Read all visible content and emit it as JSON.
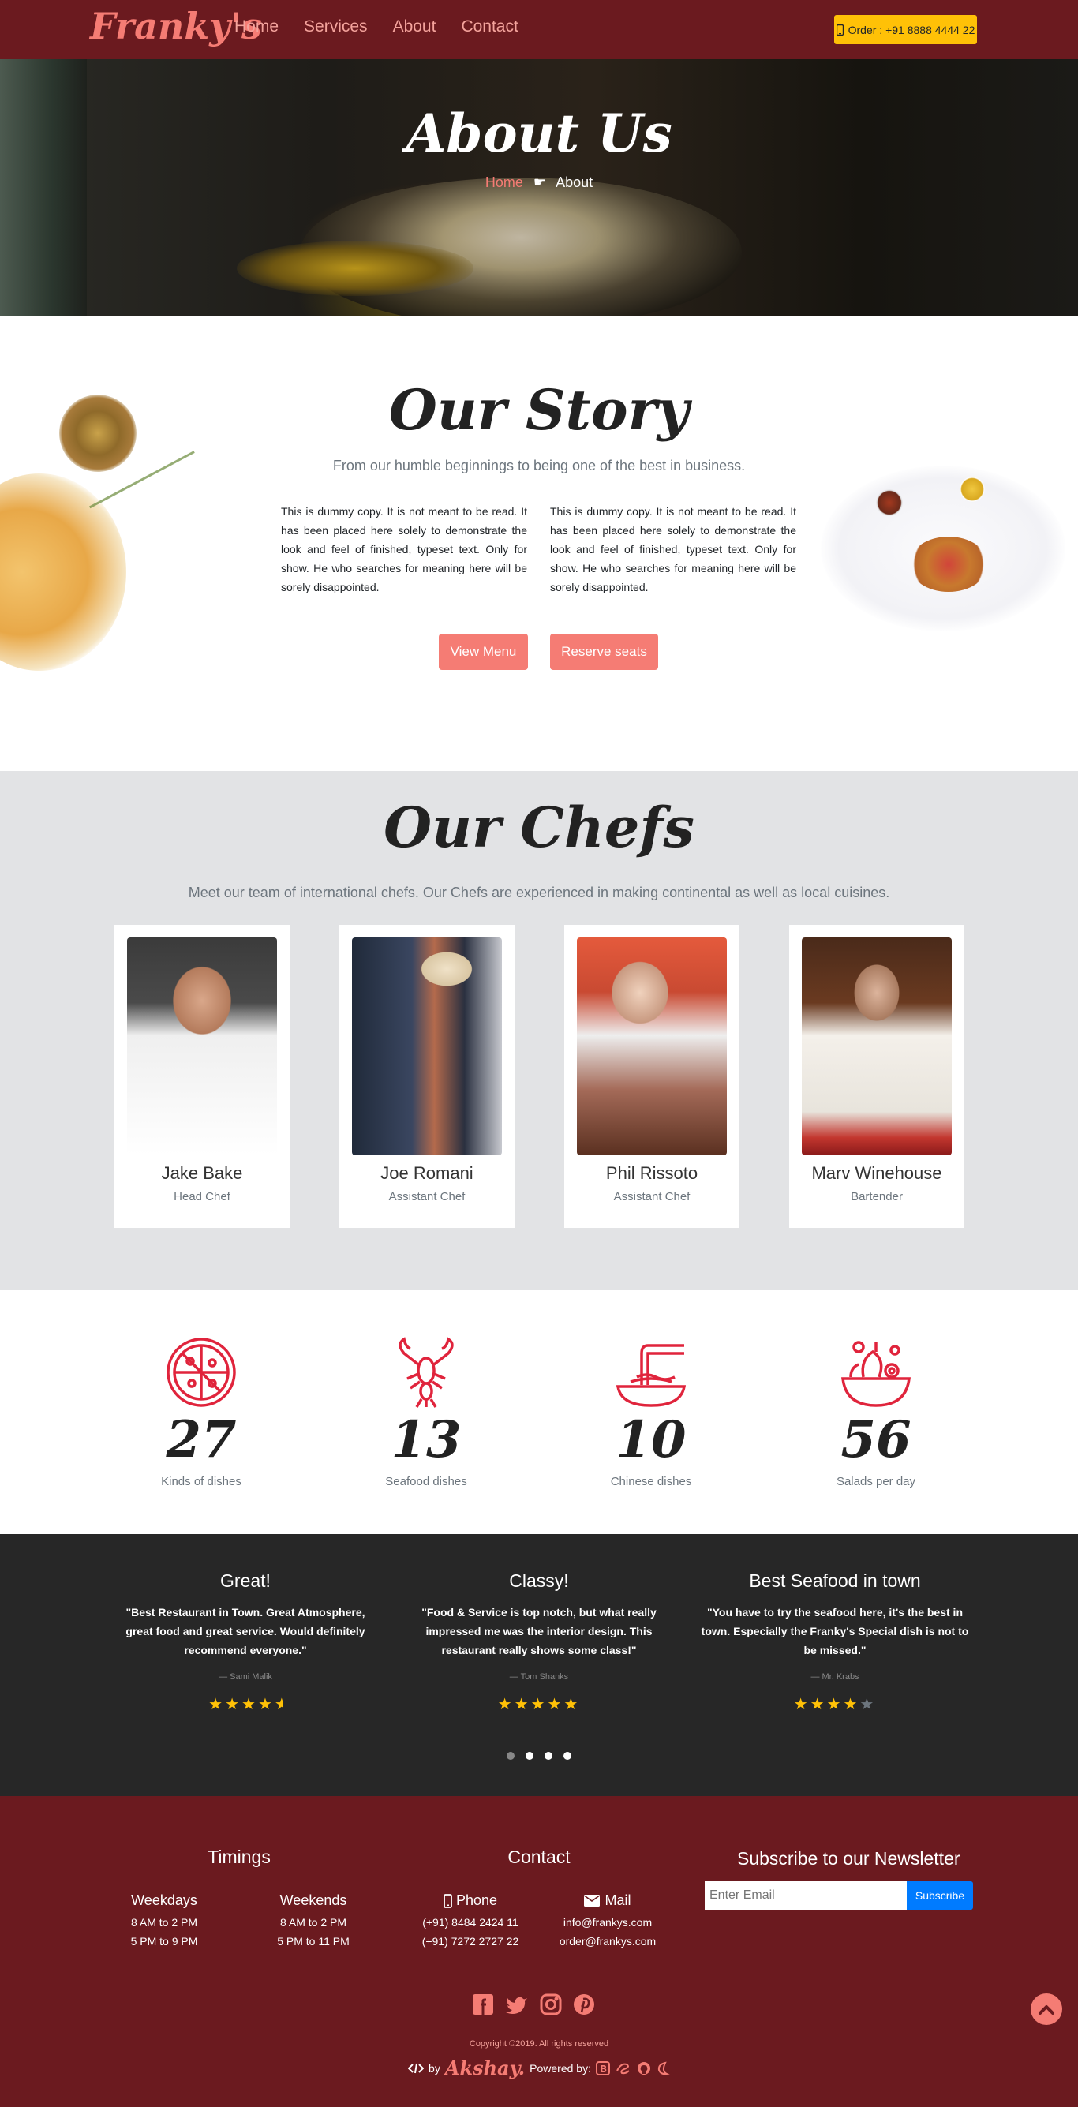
{
  "nav": {
    "logo": "Franky's",
    "links": [
      "Home",
      "Services",
      "About",
      "Contact"
    ],
    "order": "Order : +91 8888 4444 22"
  },
  "hero": {
    "title": "About Us",
    "breadcrumb_home": "Home",
    "breadcrumb_current": "About"
  },
  "story": {
    "title": "Our Story",
    "subtitle": "From our humble beginnings to being one of the best in business.",
    "col1": "This is dummy copy. It is not meant to be read. It has been placed here solely to demonstrate the look and feel of finished, typeset text. Only for show. He who searches for meaning here will be sorely disappointed.",
    "col2": "This is dummy copy. It is not meant to be read. It has been placed here solely to demonstrate the look and feel of finished, typeset text. Only for show. He who searches for meaning here will be sorely disappointed.",
    "btn_menu": "View Menu",
    "btn_reserve": "Reserve seats"
  },
  "chefs": {
    "title": "Our Chefs",
    "subtitle": "Meet our team of international chefs. Our Chefs are experienced in making continental as well as local cuisines.",
    "items": [
      {
        "name": "Jake Bake",
        "role": "Head Chef"
      },
      {
        "name": "Joe Romani",
        "role": "Assistant Chef"
      },
      {
        "name": "Phil Rissoto",
        "role": "Assistant Chef"
      },
      {
        "name": "Marv Winehouse",
        "role": "Bartender"
      }
    ]
  },
  "stats": [
    {
      "value": "27",
      "label": "Kinds of dishes",
      "icon": "pizza-icon"
    },
    {
      "value": "13",
      "label": "Seafood dishes",
      "icon": "lobster-icon"
    },
    {
      "value": "10",
      "label": "Chinese dishes",
      "icon": "noodles-icon"
    },
    {
      "value": "56",
      "label": "Salads per day",
      "icon": "salad-icon"
    }
  ],
  "testimonials": [
    {
      "title": "Great!",
      "quote": "\"Best Restaurant in Town. Great Atmosphere, great food and great service. Would definitely recommend everyone.\"",
      "author": "— Sami Malik",
      "rating": 4.5
    },
    {
      "title": "Classy!",
      "quote": "\"Food & Service is top notch, but what really impressed me was the interior design. This restaurant really shows some class!\"",
      "author": "— Tom Shanks",
      "rating": 5
    },
    {
      "title": "Best Seafood in town",
      "quote": "\"You have to try the seafood here, it's the best in town. Especially the Franky's Special dish is not to be missed.\"",
      "author": "— Mr. Krabs",
      "rating": 4
    }
  ],
  "footer": {
    "timings_title": "Timings",
    "weekdays": "Weekdays",
    "weekdays_1": "8 AM to 2 PM",
    "weekdays_2": "5 PM to 9 PM",
    "weekends": "Weekends",
    "weekends_1": "8 AM to 2 PM",
    "weekends_2": "5 PM to 11 PM",
    "contact_title": "Contact",
    "phone": "Phone",
    "phone_1": "(+91) 8484 2424 11",
    "phone_2": "(+91) 7272 2727 22",
    "mail": "Mail",
    "mail_1": "info@frankys.com",
    "mail_2": "order@frankys.com",
    "newsletter_title": "Subscribe to our Newsletter",
    "email_placeholder": "Enter Email",
    "subscribe": "Subscribe",
    "copyright": "Copyright ©2019. All rights reserved",
    "by": "by",
    "author": "Akshay.",
    "powered": "Powered by:"
  },
  "colors": {
    "maroon": "#6b1a1f",
    "salmon": "#f57c74",
    "accent_red": "#e0243c",
    "star": "#ffc107"
  }
}
